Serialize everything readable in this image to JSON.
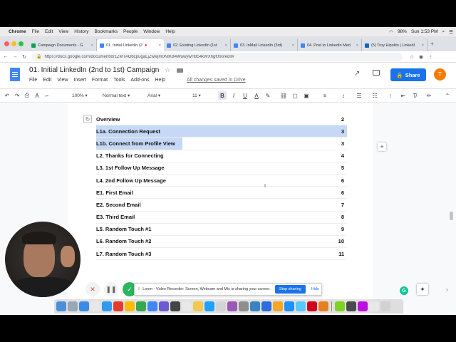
{
  "menubar": {
    "app": "Chrome",
    "items": [
      "File",
      "Edit",
      "View",
      "History",
      "Bookmarks",
      "People",
      "Window",
      "Help"
    ],
    "battery": "98%",
    "clock": "Sun 1:53 PM"
  },
  "tabs": [
    {
      "label": "Campaign Documents - G",
      "active": false
    },
    {
      "label": "01. Initial LinkedIn (2",
      "active": true
    },
    {
      "label": "02. Existing LinkedIn (1st",
      "active": false
    },
    {
      "label": "03. InMail LinkedIn (3rd)",
      "active": false
    },
    {
      "label": "04. Post to LinkedIn Med",
      "active": false
    },
    {
      "label": "(5) Troy Hipolito | LinkedI",
      "active": false
    }
  ],
  "url": "https://docs.google.com/document/d/1ZMTAO6cpugaLjZwwjm0NIKB4WuwywH854kWXhgt09o/edit#",
  "doc": {
    "title": "01. Initial LinkedIn (2nd to 1st) Campaign",
    "menu": [
      "File",
      "Edit",
      "View",
      "Insert",
      "Format",
      "Tools",
      "Add-ons",
      "Help"
    ],
    "saved_status": "All changes saved in Drive",
    "share_label": "Share",
    "avatar_letter": "T"
  },
  "toolbar": {
    "zoom": "100%",
    "style": "Normal text",
    "font": "Arial",
    "size": "11",
    "bold": "B",
    "italic": "I",
    "underline": "U",
    "text_color": "A"
  },
  "toc": [
    {
      "label": "Overview",
      "page": "2",
      "selection": "none"
    },
    {
      "label": "L1a. Connection Request",
      "page": "3",
      "selection": "full"
    },
    {
      "label": "L1b. Connect from Profile View",
      "page": "3",
      "selection": "partial"
    },
    {
      "label": "L2. Thanks for Connecting",
      "page": "4",
      "selection": "none"
    },
    {
      "label": "L3. 1st Follow Up Message",
      "page": "5",
      "selection": "none"
    },
    {
      "label": "L4. 2nd Follow Up Message",
      "page": "6",
      "selection": "none"
    },
    {
      "label": "E1. First Email",
      "page": "6",
      "selection": "none"
    },
    {
      "label": "E2. Second Email",
      "page": "7",
      "selection": "none"
    },
    {
      "label": "E3. Third Email",
      "page": "8",
      "selection": "none"
    },
    {
      "label": "L5.  Random Touch #1",
      "page": "9",
      "selection": "none"
    },
    {
      "label": "L6.  Random Touch #2",
      "page": "10",
      "selection": "none"
    },
    {
      "label": "L7.  Random Touch #3",
      "page": "11",
      "selection": "none"
    }
  ],
  "loom": {
    "message": "Loom - Video Recorder: Screen, Webcam and Mic is sharing your screen.",
    "stop_label": "Stop sharing",
    "hide_label": "Hide"
  },
  "colors": {
    "accent": "#1a73e8",
    "selection": "#c6d8f6",
    "avatar": "#f57c00"
  }
}
